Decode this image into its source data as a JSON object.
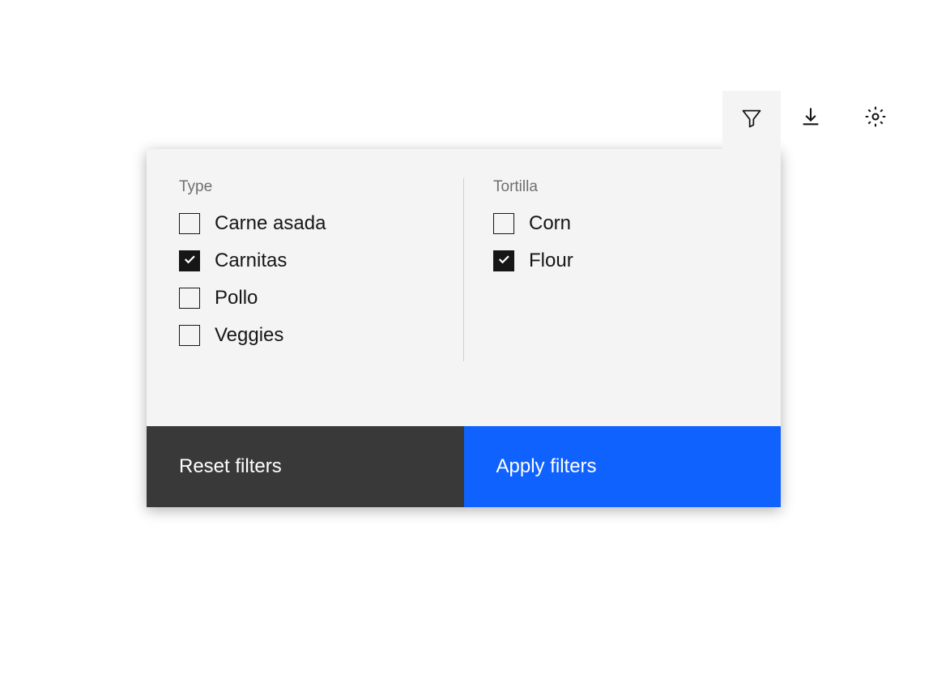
{
  "filters": {
    "columns": [
      {
        "header": "Type",
        "options": [
          {
            "label": "Carne asada",
            "checked": false
          },
          {
            "label": "Carnitas",
            "checked": true
          },
          {
            "label": "Pollo",
            "checked": false
          },
          {
            "label": "Veggies",
            "checked": false
          }
        ]
      },
      {
        "header": "Tortilla",
        "options": [
          {
            "label": "Corn",
            "checked": false
          },
          {
            "label": "Flour",
            "checked": true
          }
        ]
      }
    ]
  },
  "buttons": {
    "reset": "Reset filters",
    "apply": "Apply filters"
  }
}
